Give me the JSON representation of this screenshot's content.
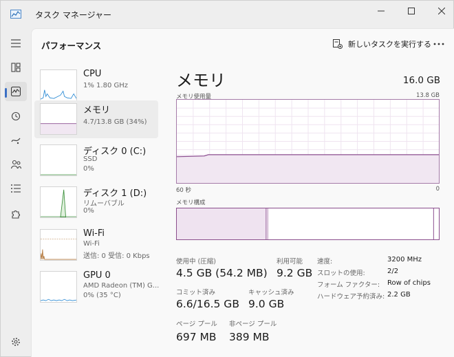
{
  "window": {
    "title": "タスク マネージャー"
  },
  "header": {
    "page_title": "パフォーマンス",
    "new_task_label": "新しいタスクを実行する"
  },
  "nav": {
    "items": [
      "menu",
      "processes",
      "performance",
      "app-history",
      "startup",
      "users",
      "details",
      "services"
    ],
    "active": "performance",
    "settings": "settings"
  },
  "sidebar": {
    "items": [
      {
        "name": "CPU",
        "sub1": "1% 1.80 GHz",
        "sub2": ""
      },
      {
        "name": "メモリ",
        "sub1": "4.7/13.8 GB (34%)",
        "sub2": ""
      },
      {
        "name": "ディスク 0 (C:)",
        "sub1": "SSD",
        "sub2": "0%"
      },
      {
        "name": "ディスク 1 (D:)",
        "sub1": "リムーバブル",
        "sub2": "0%"
      },
      {
        "name": "Wi-Fi",
        "sub1": "Wi-Fi",
        "sub2": "送信: 0 受信: 0 Kbps"
      },
      {
        "name": "GPU 0",
        "sub1": "AMD Radeon (TM) G...",
        "sub2": "0% (35 °C)"
      }
    ],
    "selected": 1
  },
  "detail": {
    "title": "メモリ",
    "total": "16.0 GB",
    "usage_label": "メモリ使用量",
    "usage_max": "13.8 GB",
    "x_left": "60 秒",
    "x_right": "0",
    "composition_label": "メモリ構成",
    "usage_fraction": 0.34,
    "composition": {
      "in_use_fraction": 0.34,
      "modified_fraction": 0.01,
      "standby_fraction": 0.63
    }
  },
  "stats": {
    "in_use": {
      "label": "使用中 (圧縮)",
      "value": "4.5 GB (54.2 MB)"
    },
    "available": {
      "label": "利用可能",
      "value": "9.2 GB"
    },
    "committed": {
      "label": "コミット済み",
      "value": "6.6/16.5 GB"
    },
    "cached": {
      "label": "キャッシュ済み",
      "value": "9.0 GB"
    },
    "paged_pool": {
      "label": "ページ プール",
      "value": "697 MB"
    },
    "nonpaged_pool": {
      "label": "非ページ プール",
      "value": "389 MB"
    }
  },
  "right_stats": [
    {
      "label": "速度:",
      "value": "3200 MHz"
    },
    {
      "label": "スロットの使用:",
      "value": "2/2"
    },
    {
      "label": "フォーム ファクター:",
      "value": "Row of chips"
    },
    {
      "label": "ハードウェア予約済み:",
      "value": "2.2 GB"
    }
  ],
  "colors": {
    "memory_line": "#8b4e8f",
    "memory_fill": "#f1e7f2",
    "cpu_line": "#2a8ad4",
    "disk_line": "#3b8f3b",
    "wifi_line": "#b3783c",
    "gpu_line": "#2a8ad4"
  }
}
